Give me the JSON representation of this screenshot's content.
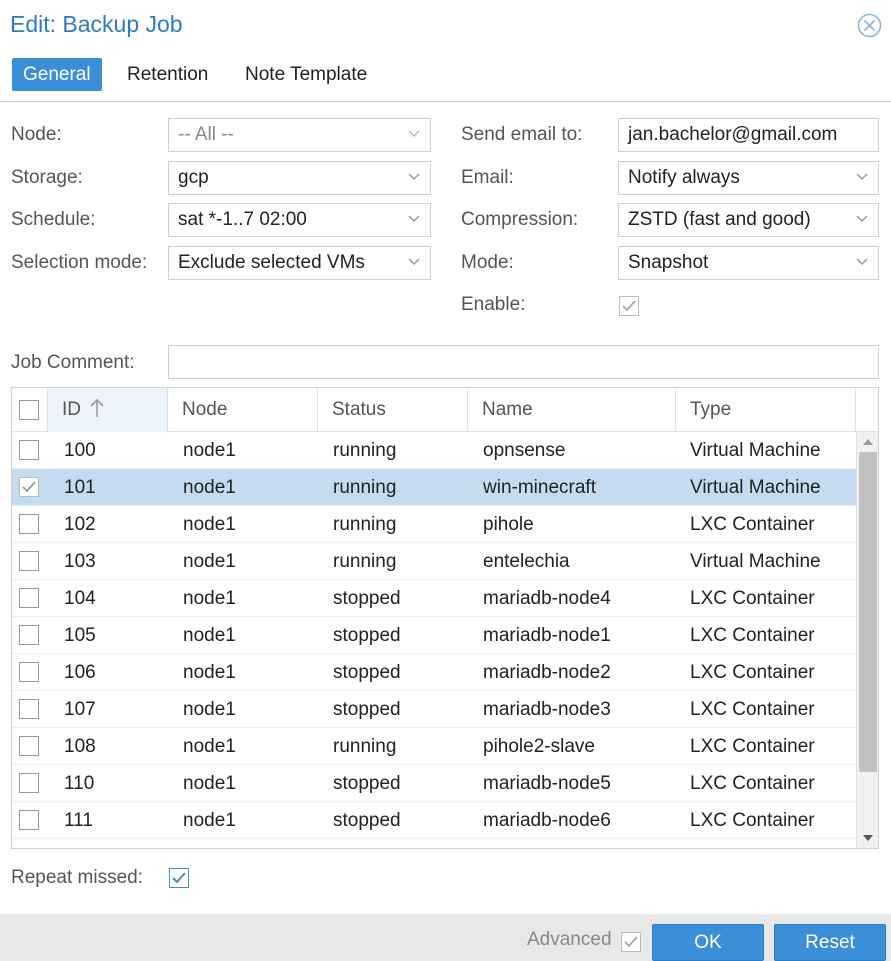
{
  "window": {
    "title": "Edit: Backup Job",
    "close_icon": "close-circle-icon"
  },
  "tabs": [
    {
      "label": "General",
      "active": true
    },
    {
      "label": "Retention",
      "active": false
    },
    {
      "label": "Note Template",
      "active": false
    }
  ],
  "form": {
    "node": {
      "label": "Node:",
      "value": "-- All --"
    },
    "storage": {
      "label": "Storage:",
      "value": "gcp"
    },
    "schedule": {
      "label": "Schedule:",
      "value": "sat *-1..7 02:00"
    },
    "selection_mode": {
      "label": "Selection mode:",
      "value": "Exclude selected VMs"
    },
    "send_email": {
      "label": "Send email to:",
      "value": "jan.bachelor@gmail.com"
    },
    "email": {
      "label": "Email:",
      "value": "Notify always"
    },
    "compression": {
      "label": "Compression:",
      "value": "ZSTD (fast and good)"
    },
    "mode": {
      "label": "Mode:",
      "value": "Snapshot"
    },
    "enable": {
      "label": "Enable:",
      "checked": true
    },
    "job_comment": {
      "label": "Job Comment:",
      "value": ""
    }
  },
  "grid": {
    "columns": [
      "ID",
      "Node",
      "Status",
      "Name",
      "Type"
    ],
    "sort_icon": "sort-ascending-icon",
    "rows": [
      {
        "id": "100",
        "node": "node1",
        "status": "running",
        "name": "opnsense",
        "type": "Virtual Machine",
        "checked": false
      },
      {
        "id": "101",
        "node": "node1",
        "status": "running",
        "name": "win-minecraft",
        "type": "Virtual Machine",
        "checked": true
      },
      {
        "id": "102",
        "node": "node1",
        "status": "running",
        "name": "pihole",
        "type": "LXC Container",
        "checked": false
      },
      {
        "id": "103",
        "node": "node1",
        "status": "running",
        "name": "entelechia",
        "type": "Virtual Machine",
        "checked": false
      },
      {
        "id": "104",
        "node": "node1",
        "status": "stopped",
        "name": "mariadb-node4",
        "type": "LXC Container",
        "checked": false
      },
      {
        "id": "105",
        "node": "node1",
        "status": "stopped",
        "name": "mariadb-node1",
        "type": "LXC Container",
        "checked": false
      },
      {
        "id": "106",
        "node": "node1",
        "status": "stopped",
        "name": "mariadb-node2",
        "type": "LXC Container",
        "checked": false
      },
      {
        "id": "107",
        "node": "node1",
        "status": "stopped",
        "name": "mariadb-node3",
        "type": "LXC Container",
        "checked": false
      },
      {
        "id": "108",
        "node": "node1",
        "status": "running",
        "name": "pihole2-slave",
        "type": "LXC Container",
        "checked": false
      },
      {
        "id": "110",
        "node": "node1",
        "status": "stopped",
        "name": "mariadb-node5",
        "type": "LXC Container",
        "checked": false
      },
      {
        "id": "111",
        "node": "node1",
        "status": "stopped",
        "name": "mariadb-node6",
        "type": "LXC Container",
        "checked": false
      }
    ]
  },
  "repeat_missed": {
    "label": "Repeat missed:",
    "checked": true
  },
  "footer": {
    "advanced_label": "Advanced",
    "advanced_checked": true,
    "ok_label": "OK",
    "reset_label": "Reset"
  },
  "colors": {
    "accent": "#3a8fd8",
    "title": "#2f7ac2",
    "selected_row": "#c5dcf0"
  }
}
